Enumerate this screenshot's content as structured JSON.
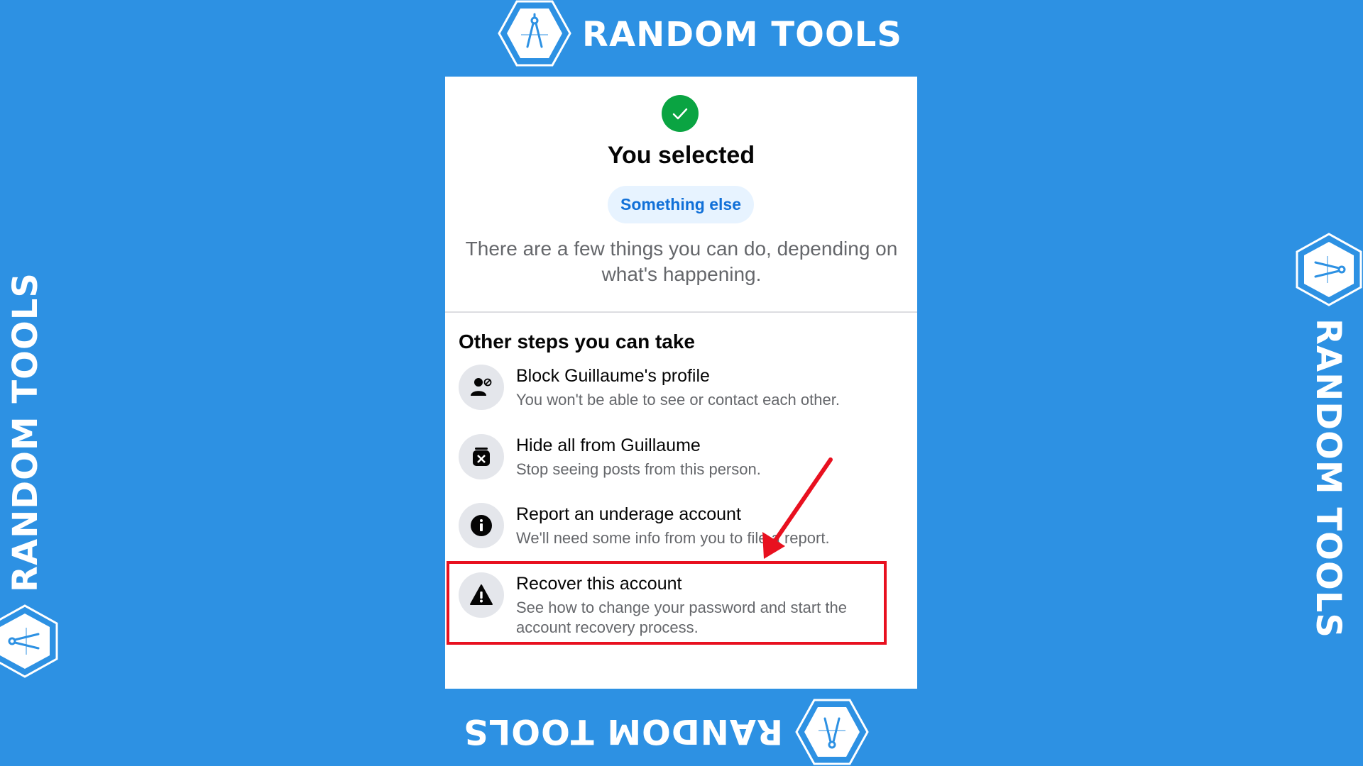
{
  "watermark": {
    "brand": "RANDOM TOOLS",
    "icon": "compass-hexagon-icon"
  },
  "confirmation": {
    "icon": "check-circle-icon",
    "title": "You selected",
    "selected_option": "Something else",
    "description": "There are a few things you can do, depending on what's happening."
  },
  "other_steps": {
    "heading": "Other steps you can take",
    "items": [
      {
        "icon": "block-user-icon",
        "title": "Block Guillaume's profile",
        "subtitle": "You won't be able to see or contact each other."
      },
      {
        "icon": "hide-box-icon",
        "title": "Hide all from Guillaume",
        "subtitle": "Stop seeing posts from this person."
      },
      {
        "icon": "info-icon",
        "title": "Report an underage account",
        "subtitle": "We'll need some info from you to file a report."
      },
      {
        "icon": "warning-icon",
        "title": "Recover this account",
        "subtitle": "See how to change your password and start the account recovery process."
      }
    ]
  },
  "annotation": {
    "highlighted_item": "Recover this account",
    "highlight_color": "#e8101f"
  },
  "colors": {
    "background": "#2d91e3",
    "success": "#0aa442",
    "pill_bg": "#e7f3ff",
    "pill_text": "#1170d8"
  }
}
